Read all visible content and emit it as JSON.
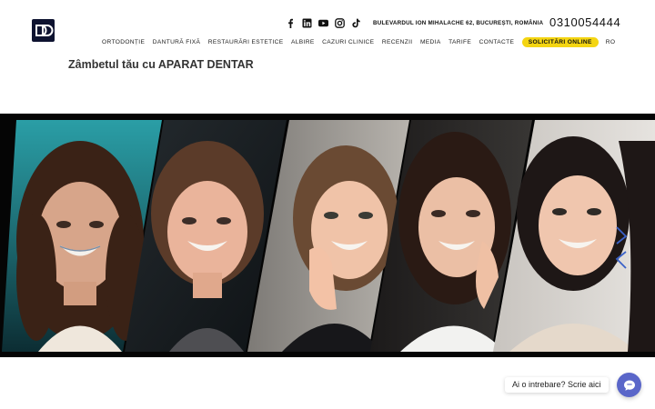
{
  "header": {
    "logo_alt": "AD",
    "socials": [
      "facebook-icon",
      "linkedin-icon",
      "youtube-icon",
      "instagram-icon",
      "tiktok-icon"
    ],
    "address": "BULEVARDUL ION MIHALACHE 62, BUCUREȘTI, ROMÂNIA",
    "phone": "0310054444"
  },
  "nav": {
    "items": [
      "ORTODONȚIE",
      "DANTURĂ FIXĂ",
      "RESTAURĂRI ESTETICE",
      "ALBIRE",
      "CAZURI CLINICE",
      "RECENZII",
      "MEDIA",
      "TARIFE",
      "CONTACTE"
    ],
    "cta": "SOLICITĂRI ONLINE",
    "language": "RO"
  },
  "tagline": "Zâmbetul tău cu APARAT DENTAR",
  "hero": {
    "image": "five-smiling-young-women-collage",
    "prev_icon": "chevron-up-icon",
    "next_icon": "chevron-down-icon"
  },
  "chat": {
    "label": "Ai o intrebare? Scrie aici",
    "icon": "chat-bubble-icon"
  },
  "colors": {
    "accent_yellow": "#f4d512",
    "logo_navy": "#0e1330",
    "arrow_blue": "#3b62c8",
    "chat_purple": "#5a66c9"
  }
}
